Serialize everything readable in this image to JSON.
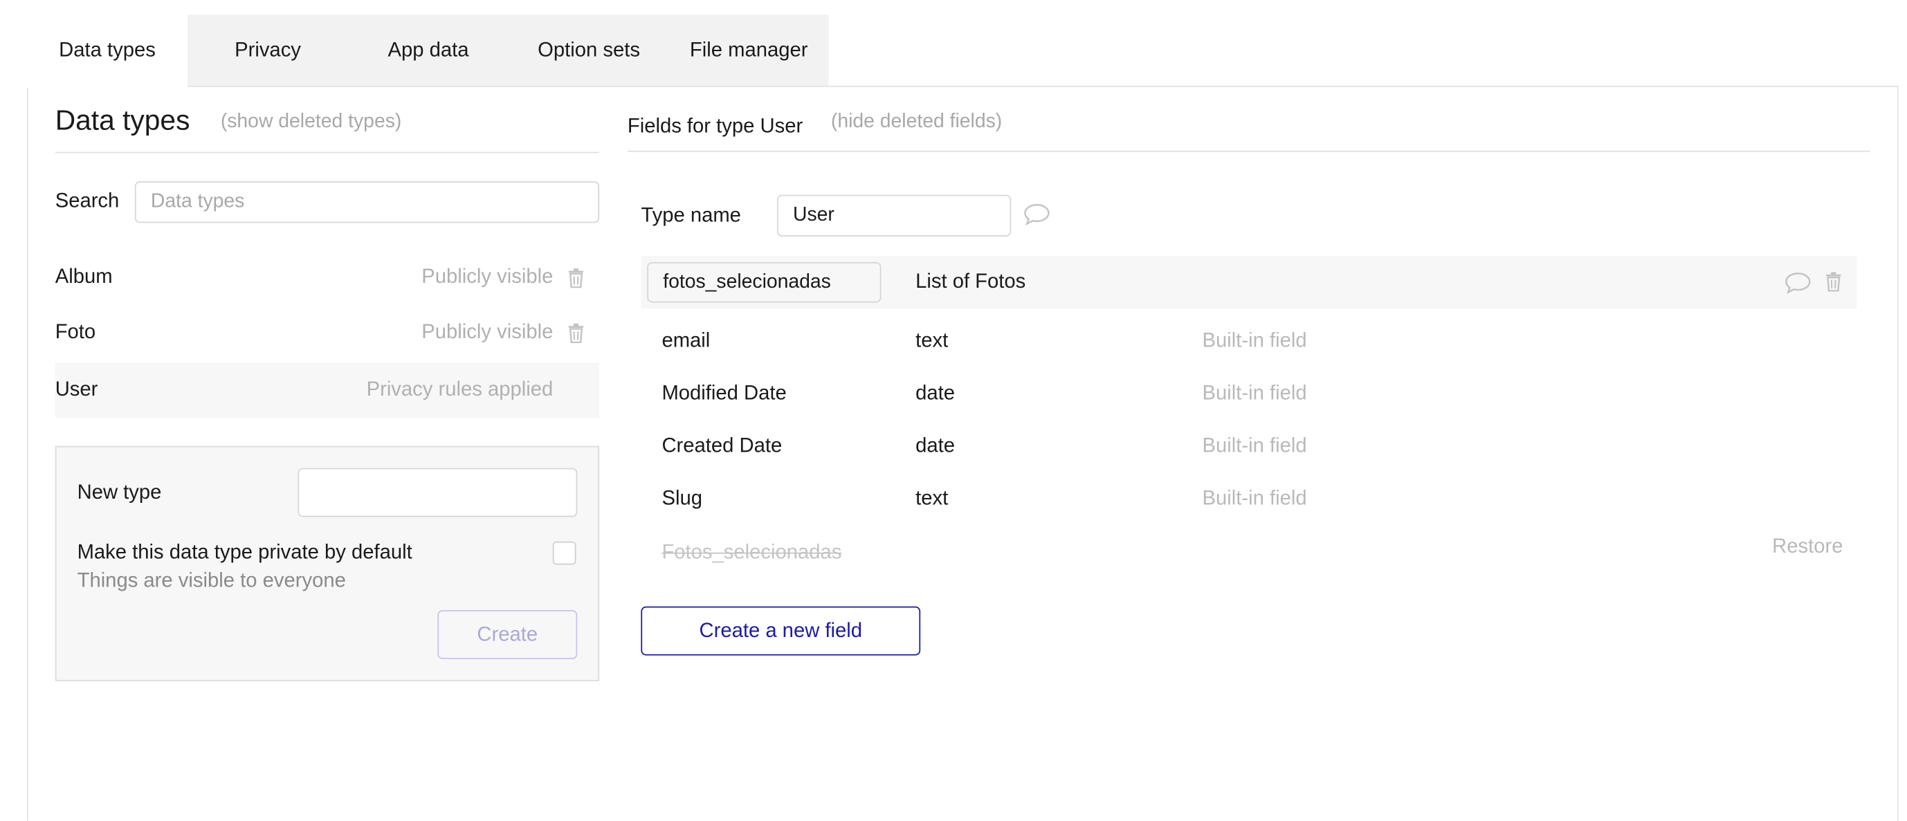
{
  "tabs": [
    {
      "label": "Data types",
      "active": true
    },
    {
      "label": "Privacy",
      "active": false
    },
    {
      "label": "App data",
      "active": false
    },
    {
      "label": "Option sets",
      "active": false
    },
    {
      "label": "File manager",
      "active": false
    }
  ],
  "left": {
    "title": "Data types",
    "show_deleted_link": "(show deleted types)",
    "search_label": "Search",
    "search_placeholder": "Data types",
    "types": [
      {
        "name": "Album",
        "status": "Publicly visible"
      },
      {
        "name": "Foto",
        "status": "Publicly visible"
      },
      {
        "name": "User",
        "status": "Privacy rules applied"
      }
    ],
    "new_type": {
      "label": "New type",
      "value": "",
      "private_label": "Make this data type private by default",
      "private_hint": "Things are visible to everyone",
      "private_checked": false,
      "create_button": "Create"
    }
  },
  "right": {
    "title": "Fields for type User",
    "hide_deleted_link": "(hide deleted fields)",
    "type_name_label": "Type name",
    "type_name_value": "User",
    "fields": [
      {
        "name": "fotos_selecionadas",
        "type": "List of Fotos",
        "note": ""
      },
      {
        "name": "email",
        "type": "text",
        "note": "Built-in field"
      },
      {
        "name": "Modified Date",
        "type": "date",
        "note": "Built-in field"
      },
      {
        "name": "Created Date",
        "type": "date",
        "note": "Built-in field"
      },
      {
        "name": "Slug",
        "type": "text",
        "note": "Built-in field"
      }
    ],
    "deleted_field": {
      "name": "Fotos_selecionadas",
      "action": "Restore"
    },
    "create_field_button": "Create a new field"
  },
  "colors": {
    "accent": "#1a1aa8",
    "muted_text": "#a8a8a8",
    "row_highlight": "#f7f7f7"
  }
}
